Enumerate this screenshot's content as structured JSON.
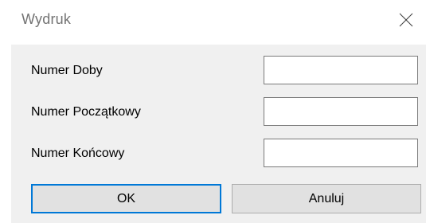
{
  "window": {
    "title": "Wydruk",
    "close_icon": "close-icon"
  },
  "form": {
    "fields": [
      {
        "label": "Numer Doby",
        "value": ""
      },
      {
        "label": "Numer Początkowy",
        "value": ""
      },
      {
        "label": "Numer Końcowy",
        "value": ""
      }
    ]
  },
  "buttons": {
    "ok_label": "OK",
    "cancel_label": "Anuluj"
  },
  "colors": {
    "focus_border": "#0078d7",
    "button_face": "#e1e1e1",
    "dialog_background": "#f0f0f0"
  }
}
